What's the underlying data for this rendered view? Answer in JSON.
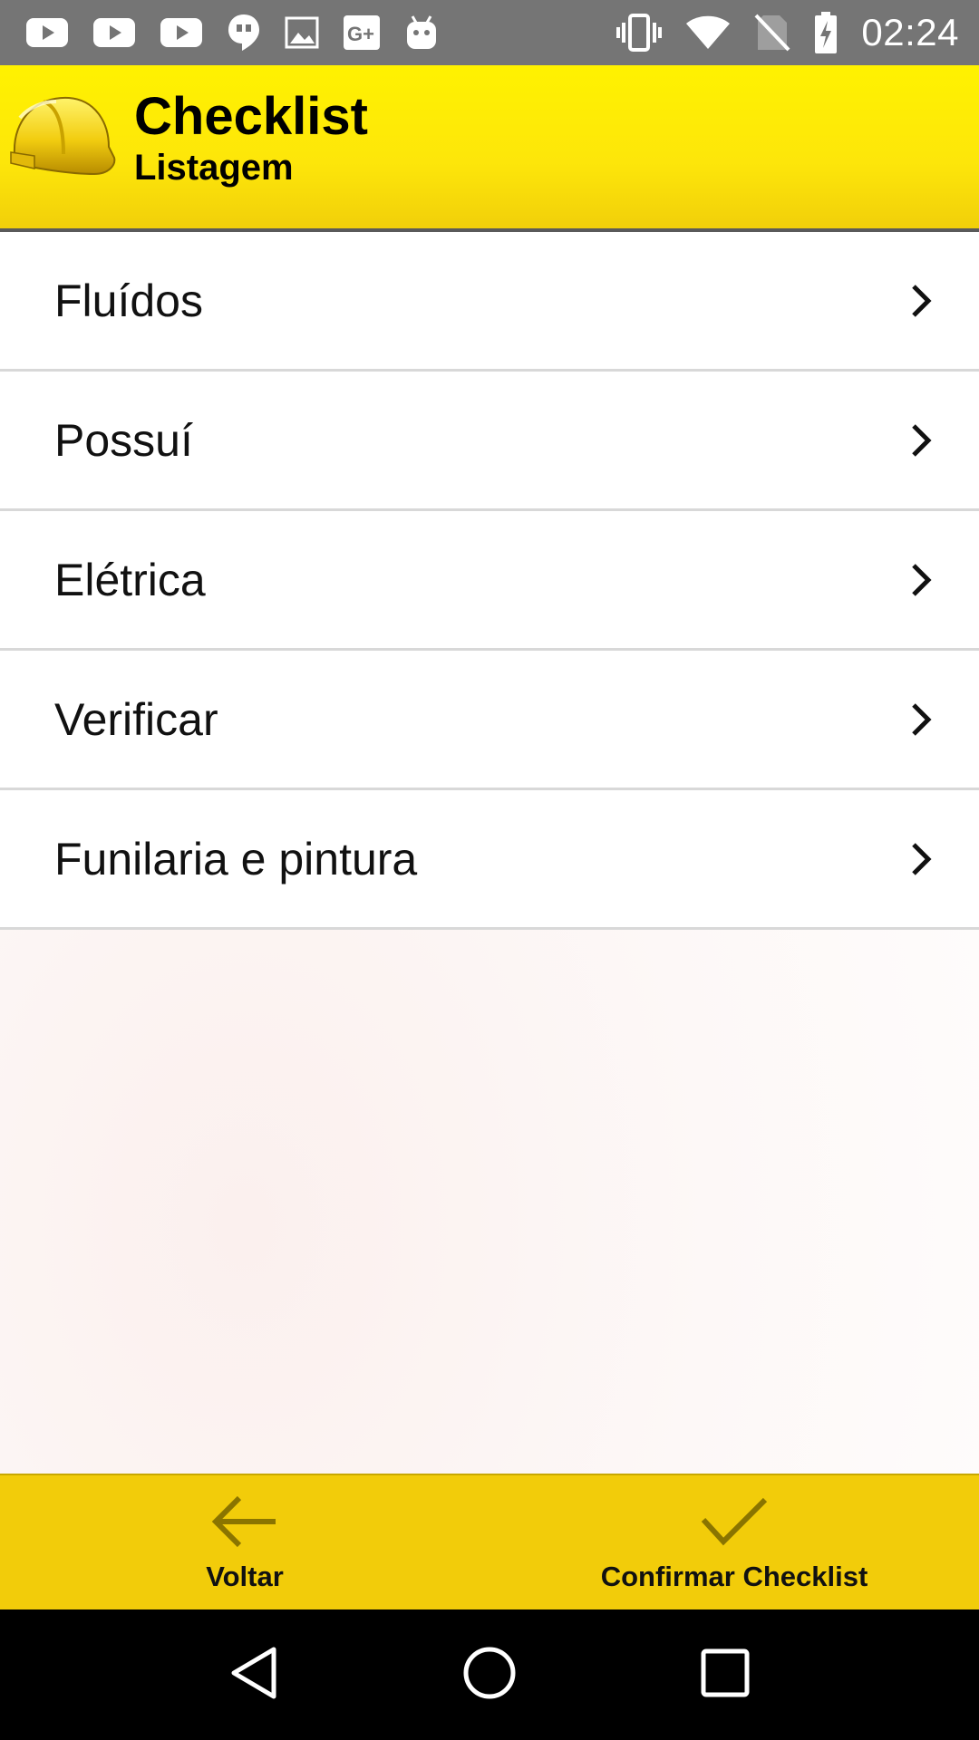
{
  "status_bar": {
    "time": "02:24",
    "left_icons": [
      "youtube-icon",
      "youtube-icon",
      "youtube-icon",
      "hangouts-icon",
      "gallery-icon",
      "google-plus-icon",
      "android-icon"
    ],
    "right_icons": [
      "vibrate-icon",
      "wifi-icon",
      "no-sim-icon",
      "battery-charging-icon"
    ]
  },
  "header": {
    "title": "Checklist",
    "subtitle": "Listagem",
    "brand_color": "#fde60a"
  },
  "list": {
    "items": [
      {
        "label": "Fluídos"
      },
      {
        "label": "Possuí"
      },
      {
        "label": "Elétrica"
      },
      {
        "label": "Verificar"
      },
      {
        "label": "Funilaria e pintura"
      }
    ]
  },
  "actions": {
    "back_label": "Voltar",
    "confirm_label": "Confirmar Checklist",
    "bar_color": "#f2cc0a",
    "icon_color": "#8a7400"
  },
  "nav": {
    "icons": [
      "back-triangle-icon",
      "home-circle-icon",
      "recents-square-icon"
    ]
  }
}
